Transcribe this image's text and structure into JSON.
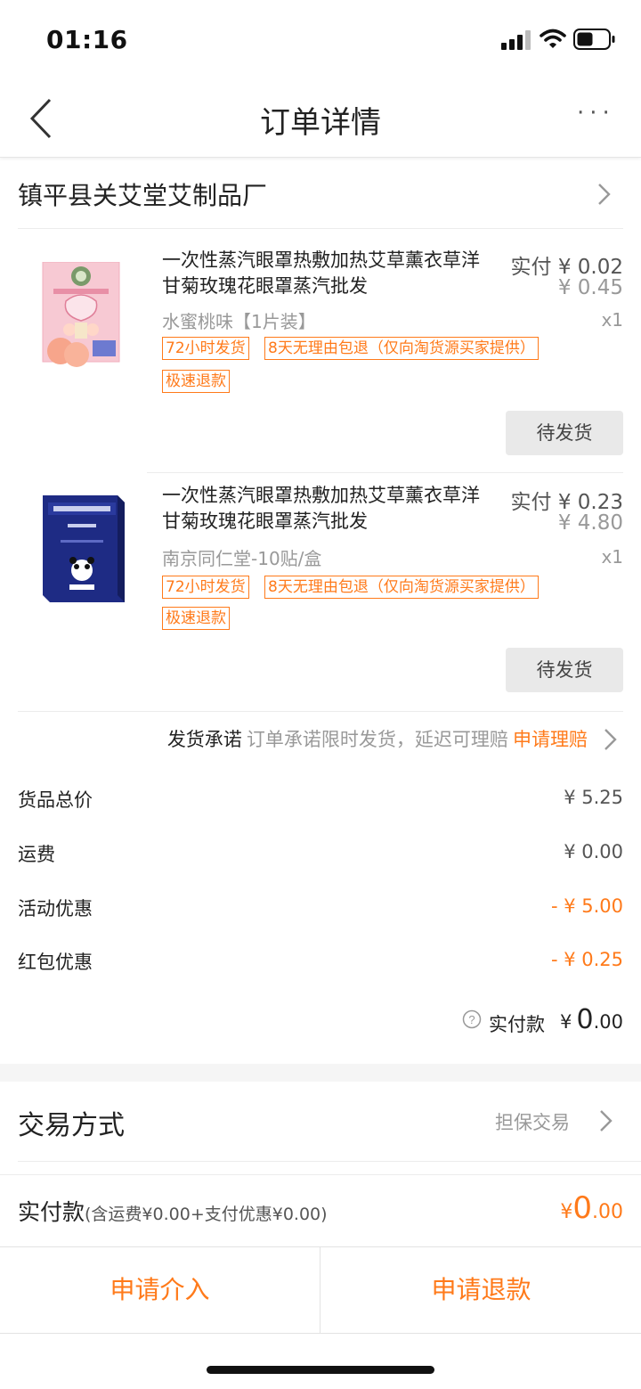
{
  "status_bar": {
    "time": "01:16"
  },
  "header": {
    "title": "订单详情",
    "more": "···"
  },
  "seller": {
    "name": "镇平县关艾堂艾制品厂"
  },
  "products": [
    {
      "title": "一次性蒸汽眼罩热敷加热艾草薰衣草洋甘菊玫瑰花眼罩蒸汽批发",
      "paid_label": "实付",
      "paid_price": "¥ 0.02",
      "original_price": "¥ 0.45",
      "spec": "水蜜桃味【1片装】",
      "qty": "x1",
      "tags": [
        "72小时发货",
        "8天无理由包退（仅向淘货源买家提供）",
        "极速退款"
      ],
      "status": "待发货"
    },
    {
      "title": "一次性蒸汽眼罩热敷加热艾草薰衣草洋甘菊玫瑰花眼罩蒸汽批发",
      "paid_label": "实付",
      "paid_price": "¥ 0.23",
      "original_price": "¥ 4.80",
      "spec": "南京同仁堂-10贴/盒",
      "qty": "x1",
      "tags": [
        "72小时发货",
        "8天无理由包退（仅向淘货源买家提供）",
        "极速退款"
      ],
      "status": "待发货"
    }
  ],
  "promise": {
    "label": "发货承诺",
    "text": "订单承诺限时发货，延迟可理赔",
    "link": "申请理赔"
  },
  "fees": [
    {
      "label": "货品总价",
      "value": "¥ 5.25"
    },
    {
      "label": "运费",
      "value": "¥ 0.00"
    },
    {
      "label": "活动优惠",
      "value": "- ¥ 5.00"
    },
    {
      "label": "红包优惠",
      "value": "- ¥ 0.25"
    }
  ],
  "paid": {
    "label": "实付款",
    "currency": "¥",
    "int": "0",
    "dec": ".00"
  },
  "transaction": {
    "label": "交易方式",
    "value": "担保交易"
  },
  "total": {
    "label": "实付款",
    "detail": "(含运费¥0.00+支付优惠¥0.00)",
    "currency": "¥",
    "int": "0",
    "dec": ".00"
  },
  "actions": {
    "intervene": "申请介入",
    "refund": "申请退款"
  },
  "colors": {
    "accent": "#ff7a1a",
    "text": "#222222",
    "muted": "#999999",
    "button_bg": "#e9e9e9"
  }
}
